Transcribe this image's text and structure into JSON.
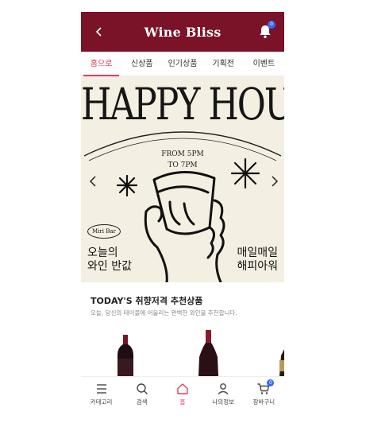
{
  "header": {
    "title": "Wine Bliss",
    "notification_count": "0",
    "brand_color": "#7a1228"
  },
  "tabs": [
    {
      "label": "홈으로",
      "active": true
    },
    {
      "label": "신상품",
      "active": false
    },
    {
      "label": "인기상품",
      "active": false
    },
    {
      "label": "기획전",
      "active": false
    },
    {
      "label": "이벤트",
      "active": false
    }
  ],
  "banner": {
    "headline": "HAPPY HOUR",
    "time_line1": "FROM 5PM",
    "time_line2": "TO 7PM",
    "bar_name": "Miri Bar",
    "left_line1": "오늘의",
    "left_line2": "와인 반값",
    "right_line1": "매일매일",
    "right_line2": "해피아워"
  },
  "recommend": {
    "title": "TODAY'S 취향저격 추천상품",
    "subtitle": "오늘, 당신의 테이블에 어울리는 완벽한 와인을 추천합니다."
  },
  "bottom_nav": [
    {
      "label": "카테고리",
      "icon": "menu-icon",
      "active": false
    },
    {
      "label": "검색",
      "icon": "search-icon",
      "active": false
    },
    {
      "label": "홈",
      "icon": "home-icon",
      "active": true
    },
    {
      "label": "나의정보",
      "icon": "user-icon",
      "active": false
    },
    {
      "label": "장바구니",
      "icon": "cart-icon",
      "active": false,
      "badge": "0"
    }
  ],
  "accent_color": "#e0405d"
}
